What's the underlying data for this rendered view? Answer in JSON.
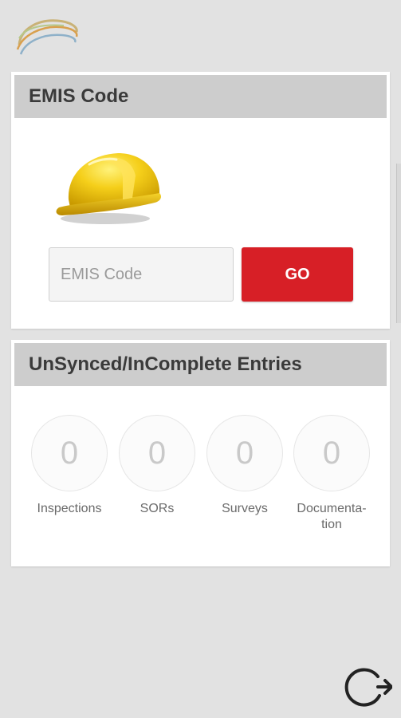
{
  "logo": {
    "icon": "company-logo-icon"
  },
  "emis_card": {
    "title": "EMIS Code",
    "icon": "hard-hat-icon",
    "input": {
      "placeholder": "EMIS Code",
      "value": ""
    },
    "go_label": "GO",
    "colors": {
      "go_button": "#d71f26"
    }
  },
  "unsynced_card": {
    "title": "UnSynced/InComplete Entries",
    "stats": [
      {
        "label": "Inspections",
        "count": "0"
      },
      {
        "label": "SORs",
        "count": "0"
      },
      {
        "label": "Surveys",
        "count": "0"
      },
      {
        "label": "Documenta-\ntion",
        "count": "0"
      }
    ]
  },
  "sync_button": {
    "icon": "sync-icon"
  }
}
